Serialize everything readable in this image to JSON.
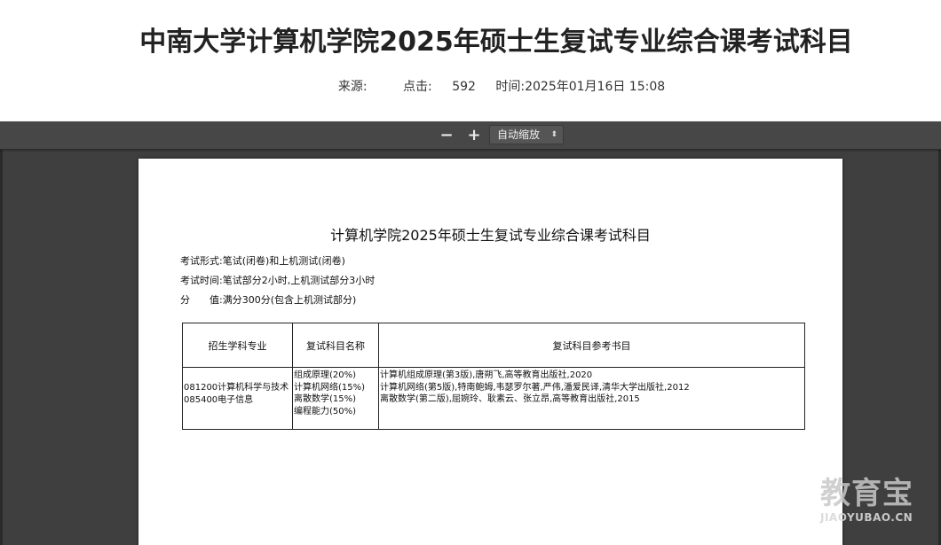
{
  "article": {
    "title": "中南大学计算机学院2025年硕士生复试专业综合课考试科目",
    "meta": {
      "source_label": "来源:",
      "source_value": "",
      "clicks_label": "点击:",
      "clicks_value": "592",
      "time_label": "时间:",
      "time_value": "2025年01月16日 15:08"
    }
  },
  "viewer": {
    "zoom_out_label": "−",
    "zoom_in_label": "+",
    "zoom_select_value": "自动缩放",
    "zoom_select_arrows": "⬍"
  },
  "document": {
    "title": "计算机学院2025年硕士生复试专业综合课考试科目",
    "line1": "考试形式:笔试(闭卷)和上机测试(闭卷)",
    "line2": "考试时间:笔试部分2小时,上机测试部分3小时",
    "line3": "分　　值:满分300分(包含上机测试部分)",
    "table": {
      "headers": [
        "招生学科专业",
        "复试科目名称",
        "复试科目参考书目"
      ],
      "majors": [
        "081200计算机科学与技术",
        "085400电子信息"
      ],
      "subjects": [
        "组成原理(20%)",
        "计算机网络(15%)",
        "离散数学(15%)",
        "编程能力(50%)"
      ],
      "books": [
        "计算机组成原理(第3版),唐朔飞,高等教育出版社,2020",
        "计算机网络(第5版),特南鲍姆,韦瑟罗尔著,严伟,潘爱民译,清华大学出版社,2012",
        "离散数学(第二版),屈婉玲、耿素云、张立昂,高等教育出版社,2015"
      ]
    }
  },
  "watermark": {
    "main": "教育宝",
    "sub": "JIAOYUBAO.CN"
  }
}
